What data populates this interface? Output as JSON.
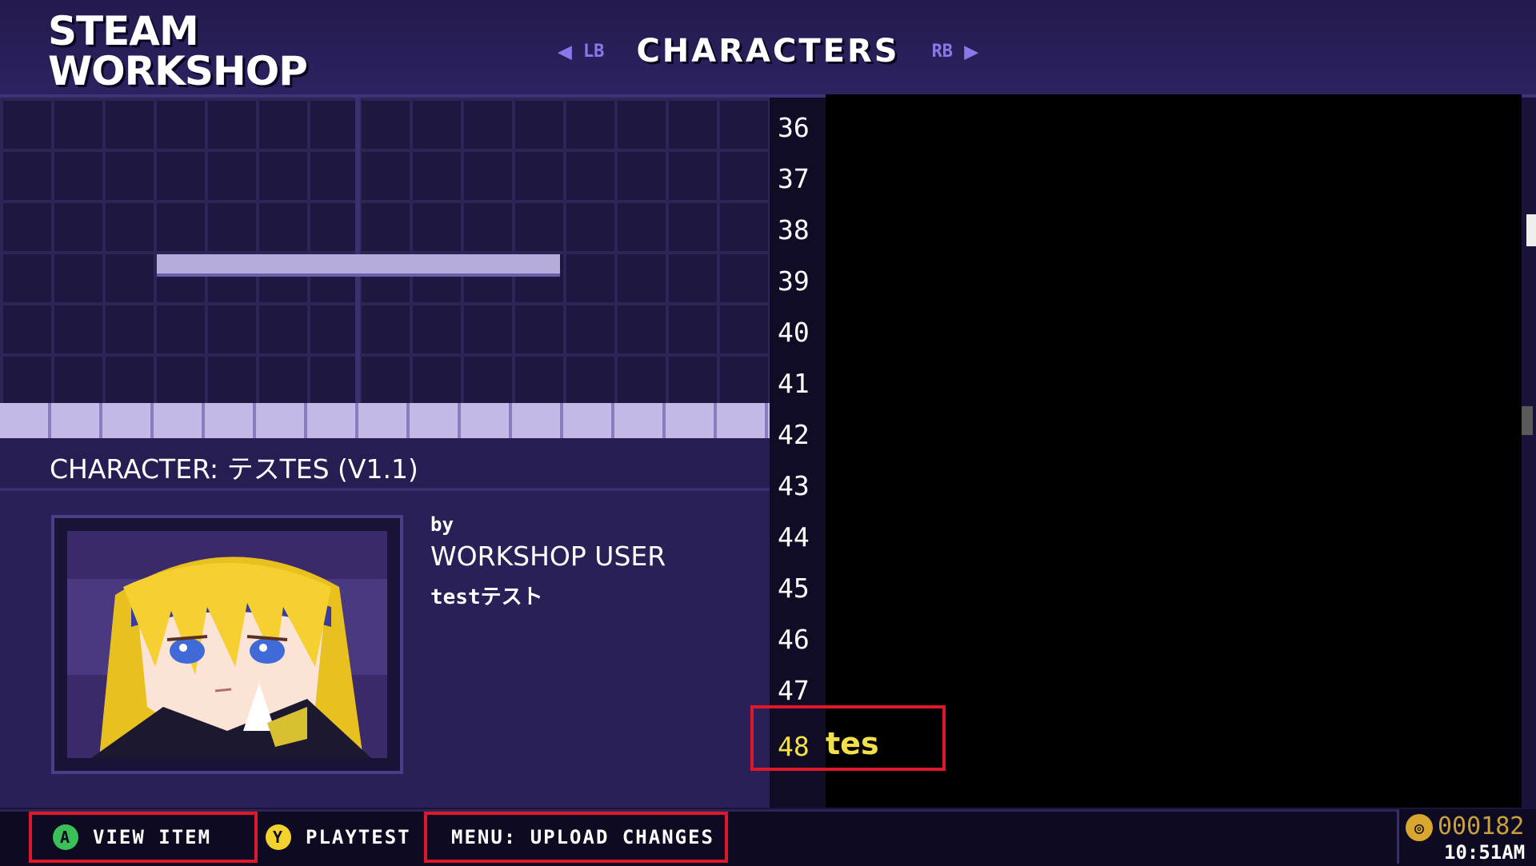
{
  "header": {
    "logo_line1": "STEAM",
    "logo_line2": "WORKSHOP",
    "nav_left_hint": "LB",
    "tab_title": "CHARACTERS",
    "nav_right_hint": "RB"
  },
  "item": {
    "title": "CHARACTER: テスTES (V1.1)",
    "by_label": "by",
    "author": "WORKSHOP USER",
    "description": "testテスト"
  },
  "editor": {
    "line_numbers": [
      "36",
      "37",
      "38",
      "39",
      "40",
      "41",
      "42",
      "43",
      "44",
      "45",
      "46",
      "47",
      "48"
    ],
    "active_line_number": "48",
    "active_line_text": "tes"
  },
  "actions": {
    "view_item_badge": "A",
    "view_item_label": "VIEW ITEM",
    "playtest_badge": "Y",
    "playtest_label": "PLAYTEST",
    "upload_label": "MENU: UPLOAD CHANGES"
  },
  "status": {
    "coins": "000182",
    "time": "10:51AM"
  },
  "colors": {
    "highlight_box": "#e0162a",
    "active_text": "#f2e04a",
    "accent": "#8a78ea"
  }
}
